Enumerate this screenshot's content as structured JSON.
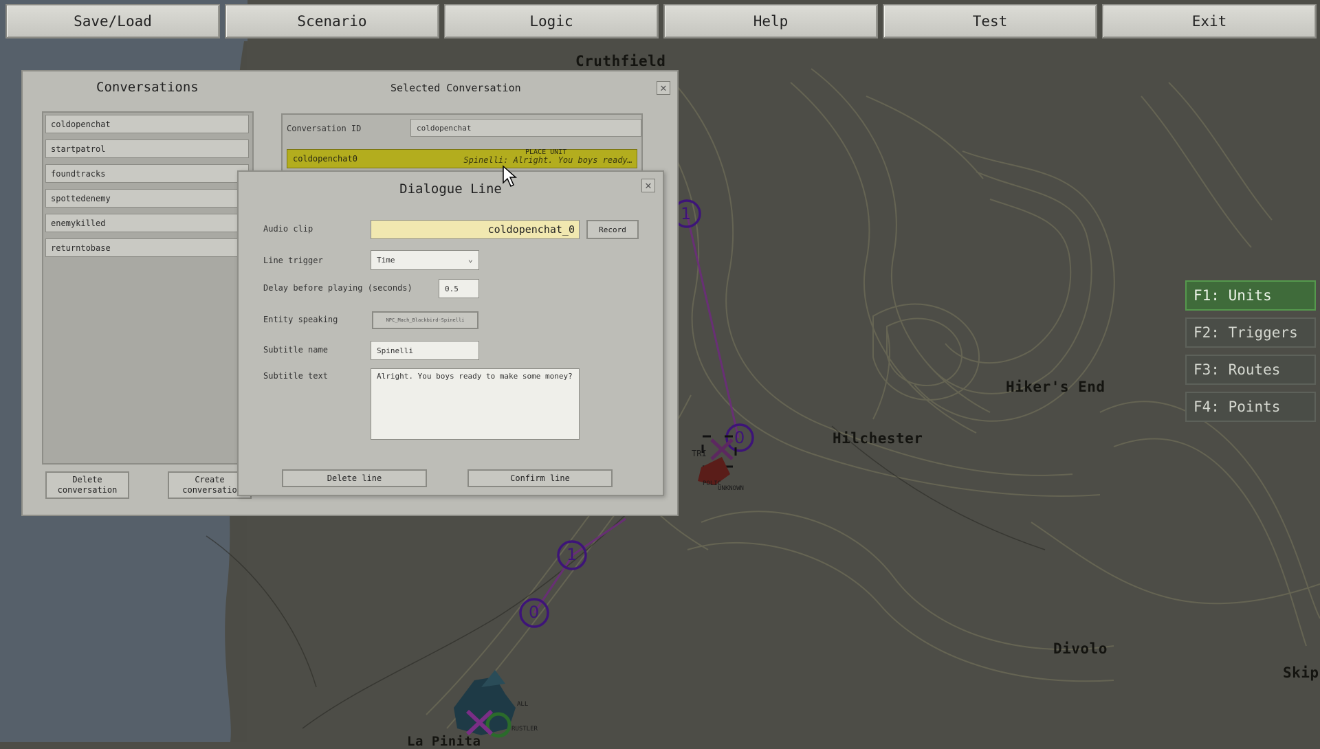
{
  "toolbar": {
    "buttons": [
      "Save/Load",
      "Scenario",
      "Logic",
      "Help",
      "Test",
      "Exit"
    ]
  },
  "map": {
    "labels": [
      "Cruthfield",
      "Hiker's End",
      "Hilchester",
      "Divolo",
      "Skip",
      "La Pinita"
    ],
    "waypoints": [
      "1",
      "0",
      "1",
      "0"
    ],
    "unit_tags": [
      "TRI",
      "POLIC",
      "UNKNOWN",
      "ALL",
      "RUSTLER"
    ]
  },
  "right_panel": {
    "tabs": [
      "F1: Units",
      "F2: Triggers",
      "F3: Routes",
      "F4: Points"
    ],
    "active_color": "#3f6b3a"
  },
  "conversations": {
    "title": "Conversations",
    "items": [
      "coldopenchat",
      "startpatrol",
      "foundtracks",
      "spottedenemy",
      "enemykilled",
      "returntobase"
    ],
    "delete_label": "Delete conversation",
    "create_label": "Create conversatio",
    "close_icon": "close-icon"
  },
  "selected_conversation": {
    "title": "Selected Conversation",
    "id_label": "Conversation ID",
    "id_value": "coldopenchat",
    "line_id": "coldopenchat0",
    "line_tag": "PLACE UNIT",
    "line_preview": "Spinelli: Alright. You boys ready…",
    "highlight_color": "#b3ad1e"
  },
  "dialogue_line": {
    "title": "Dialogue Line",
    "audio_clip_label": "Audio clip",
    "audio_clip_value": "coldopenchat_0",
    "record_label": "Record",
    "line_trigger_label": "Line trigger",
    "line_trigger_value": "Time",
    "delay_label": "Delay before playing (seconds)",
    "delay_value": "0.5",
    "entity_label": "Entity speaking",
    "entity_value": "NPC_Mach_Blackbird-Spinelli",
    "subtitle_name_label": "Subtitle name",
    "subtitle_name_value": "Spinelli",
    "subtitle_text_label": "Subtitle text",
    "subtitle_text_value": "Alright. You boys ready to make some money?",
    "delete_line_label": "Delete line",
    "confirm_line_label": "Confirm line",
    "audio_highlight": "#f1e8b0"
  }
}
